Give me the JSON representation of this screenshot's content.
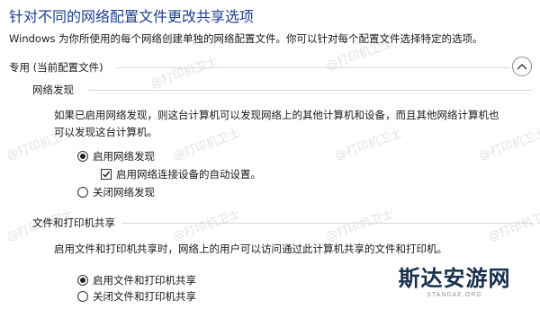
{
  "header": {
    "title": "针对不同的网络配置文件更改共享选项",
    "description": "Windows 为你所使用的每个网络创建单独的网络配置文件。你可以针对每个配置文件选择特定的选项。"
  },
  "profile": {
    "title": "专用 (当前配置文件)",
    "collapse_icon": "chevron-up-icon"
  },
  "network_discovery": {
    "title": "网络发现",
    "description_line1": "如果已启用网络发现，则这台计算机可以发现网络上的其他计算机和设备，而且其他网络计算机也",
    "description_line2": "可以发现这台计算机。",
    "option_on": "启用网络发现",
    "option_on_selected": true,
    "auto_setup": "启用网络连接设备的自动设置。",
    "auto_setup_checked": true,
    "option_off": "关闭网络发现"
  },
  "file_printer_sharing": {
    "title": "文件和打印机共享",
    "description": "启用文件和打印机共享时，网络上的用户可以访问通过此计算机共享的文件和打印机。",
    "option_on": "启用文件和打印机共享",
    "option_on_selected": true,
    "option_off": "关闭文件和打印机共享"
  },
  "watermark": {
    "text": "@打印机卫士"
  },
  "brand": {
    "name": "斯达安游网",
    "domain": "STANDAE.ORG"
  }
}
